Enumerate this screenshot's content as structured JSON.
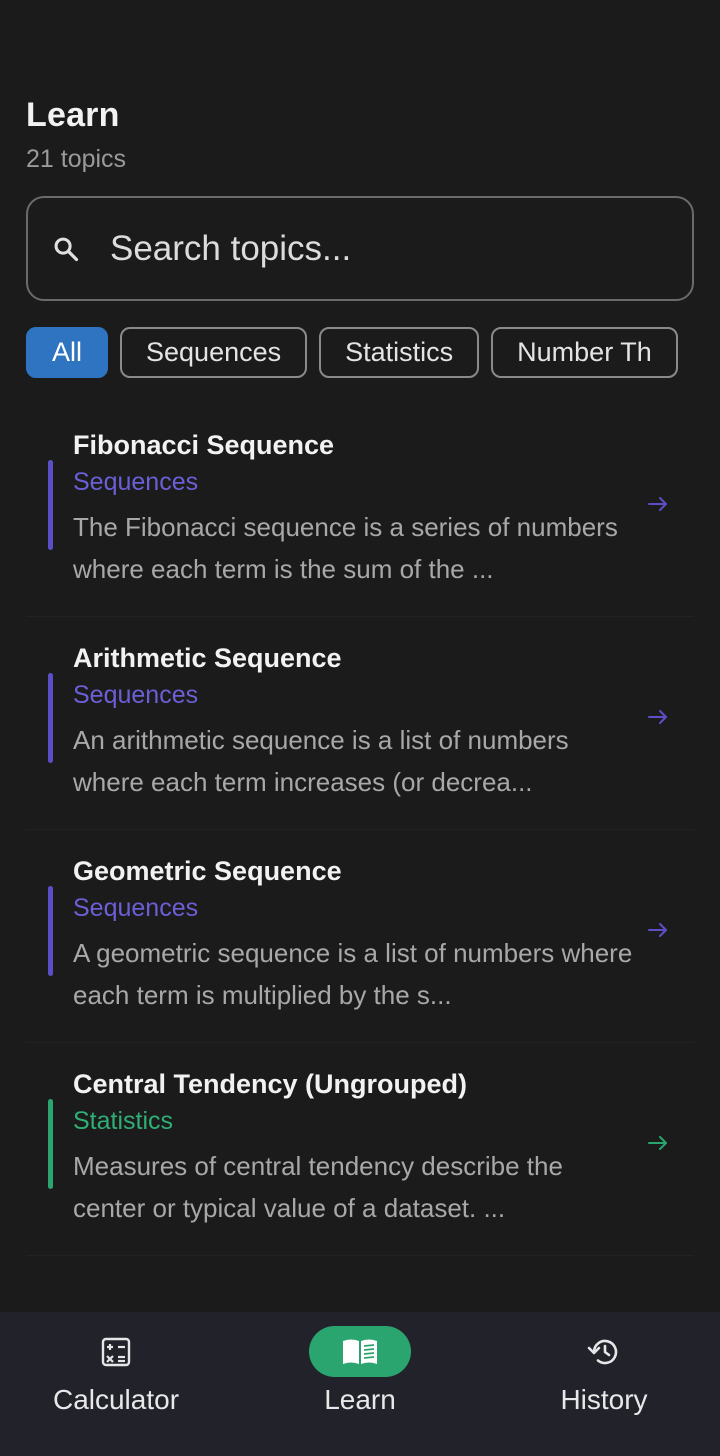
{
  "header": {
    "title": "Learn",
    "count": "21 topics"
  },
  "search": {
    "placeholder": "Search topics..."
  },
  "filters": [
    "All",
    "Sequences",
    "Statistics",
    "Number Th"
  ],
  "topics": [
    {
      "title": "Fibonacci Sequence",
      "category": "Sequences",
      "description": "The Fibonacci sequence is a series of numbers where each term is the sum of the ...",
      "color": "#5b4fc7",
      "category_color": "#6b5fd6"
    },
    {
      "title": "Arithmetic Sequence",
      "category": "Sequences",
      "description": "An arithmetic sequence is a list of numbers where each term increases (or decrea...",
      "color": "#5b4fc7",
      "category_color": "#6b5fd6"
    },
    {
      "title": "Geometric Sequence",
      "category": "Sequences",
      "description": "A geometric sequence is a list of numbers where each term is multiplied by the s...",
      "color": "#5b4fc7",
      "category_color": "#6b5fd6"
    },
    {
      "title": "Central Tendency (Ungrouped)",
      "category": "Statistics",
      "description": "Measures of central tendency describe the center or typical value of a dataset. ...",
      "color": "#2aa56f",
      "category_color": "#2fae75"
    }
  ],
  "nav": {
    "calculator": "Calculator",
    "learn": "Learn",
    "history": "History"
  },
  "colors": {
    "background": "#1b1b1b",
    "chip_active": "#2f74c0",
    "nav_active": "#2aa56f",
    "nav_background": "#22232a"
  }
}
